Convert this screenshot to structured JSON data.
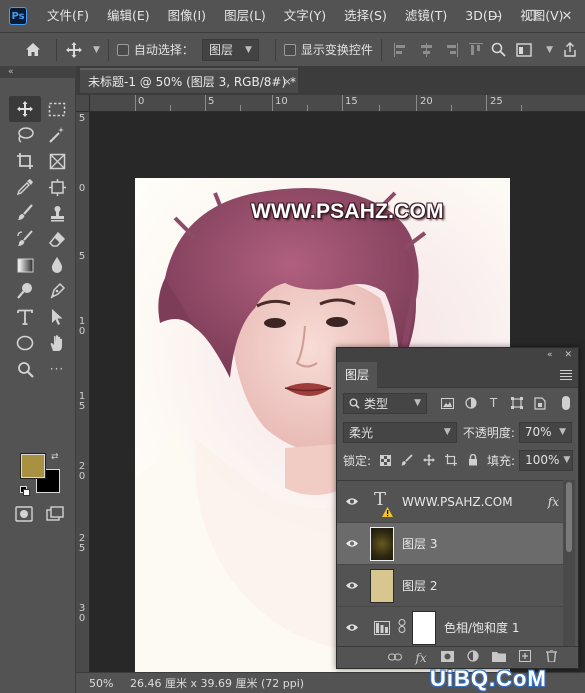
{
  "app": {
    "logo": "Ps"
  },
  "menu": [
    "文件(F)",
    "编辑(E)",
    "图像(I)",
    "图层(L)",
    "文字(Y)",
    "选择(S)",
    "滤镜(T)",
    "3D(D)",
    "视图(V)"
  ],
  "window_buttons": {
    "minimize": "—",
    "restore": "❐",
    "close": "✕"
  },
  "options_bar": {
    "auto_select_label": "自动选择：",
    "auto_select_value": "图层",
    "show_transform_label": "显示变换控件"
  },
  "document": {
    "tab_title": "未标题-1 @ 50% (图层 3, RGB/8#) *",
    "tab_close": "×",
    "ruler_h": [
      "0",
      "5",
      "10",
      "15",
      "20",
      "25"
    ],
    "ruler_v": [
      "5",
      "0",
      "5",
      "1\n0",
      "1\n5",
      "2\n0",
      "2\n5",
      "3\n0"
    ],
    "canvas_text": "WWW.PSAHZ.COM"
  },
  "status_bar": {
    "zoom": "50%",
    "info": "26.46 厘米 x 39.69 厘米 (72 ppi)"
  },
  "colors": {
    "foreground": "#a89140",
    "background": "#000000"
  },
  "layers_panel": {
    "title": "图层",
    "collapse": "«",
    "close": "✕",
    "filter_type": "类型",
    "blend_mode": "柔光",
    "opacity_label": "不透明度:",
    "opacity_value": "70%",
    "lock_label": "锁定:",
    "fill_label": "填充:",
    "fill_value": "100%",
    "layers": [
      {
        "name": "WWW.PSAHZ.COM",
        "kind": "text",
        "fx": "fx",
        "visible": true,
        "selected": false
      },
      {
        "name": "图层 3",
        "kind": "pixel",
        "visible": true,
        "selected": true
      },
      {
        "name": "图层 2",
        "kind": "pixel",
        "visible": true,
        "selected": false
      },
      {
        "name": "色相/饱和度 1",
        "kind": "adjustment",
        "visible": true,
        "selected": false
      }
    ],
    "footer": [
      "link-icon",
      "fx-icon",
      "mask-icon",
      "adjustment-icon",
      "folder-icon",
      "new-layer-icon",
      "trash-icon"
    ]
  },
  "site_watermark": "UiBQ.CoM"
}
